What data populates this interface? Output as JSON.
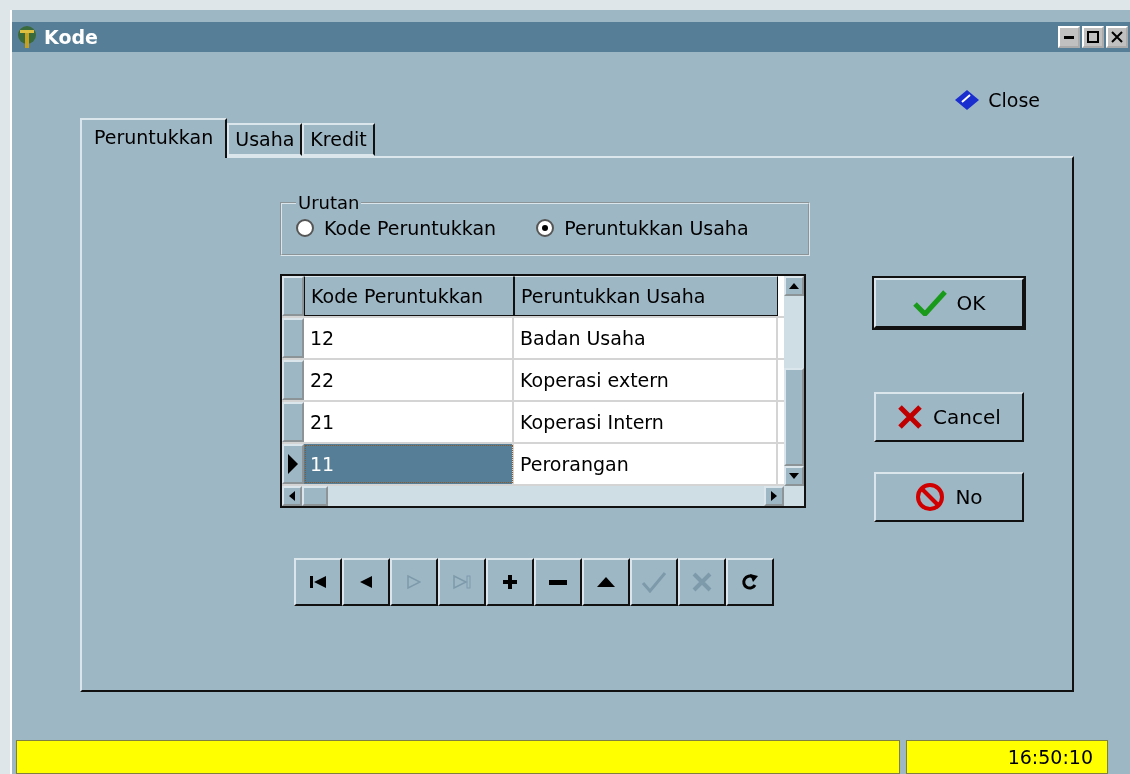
{
  "window": {
    "title": "Kode"
  },
  "close_link": {
    "label": "Close"
  },
  "tabs": [
    {
      "label": "Peruntukkan",
      "selected": true
    },
    {
      "label": "Usaha",
      "selected": false
    },
    {
      "label": "Kredit",
      "selected": false
    }
  ],
  "sort_group": {
    "title": "Urutan",
    "options": [
      {
        "label": "Kode Peruntukkan",
        "selected": false
      },
      {
        "label": "Peruntukkan Usaha",
        "selected": true
      }
    ]
  },
  "grid": {
    "columns": [
      "Kode Peruntukkan",
      "Peruntukkan Usaha"
    ],
    "rows": [
      {
        "cells": [
          "12",
          "Badan Usaha"
        ],
        "selected": false
      },
      {
        "cells": [
          "22",
          "Koperasi extern"
        ],
        "selected": false
      },
      {
        "cells": [
          "21",
          "Koperasi Intern"
        ],
        "selected": false
      },
      {
        "cells": [
          "11",
          "Perorangan"
        ],
        "selected": true
      }
    ]
  },
  "navigator": [
    {
      "kind": "first",
      "disabled": false
    },
    {
      "kind": "prior",
      "disabled": false
    },
    {
      "kind": "next",
      "disabled": true
    },
    {
      "kind": "last",
      "disabled": true
    },
    {
      "kind": "insert",
      "disabled": false
    },
    {
      "kind": "delete",
      "disabled": false
    },
    {
      "kind": "edit",
      "disabled": false
    },
    {
      "kind": "post",
      "disabled": true
    },
    {
      "kind": "cancel",
      "disabled": true
    },
    {
      "kind": "refresh",
      "disabled": false
    }
  ],
  "buttons": [
    {
      "kind": "ok",
      "label": "OK",
      "default": true
    },
    {
      "kind": "cancel",
      "label": "Cancel",
      "default": false
    },
    {
      "kind": "no",
      "label": "No",
      "default": false
    }
  ],
  "status_bar": {
    "time": "16:50:10"
  }
}
